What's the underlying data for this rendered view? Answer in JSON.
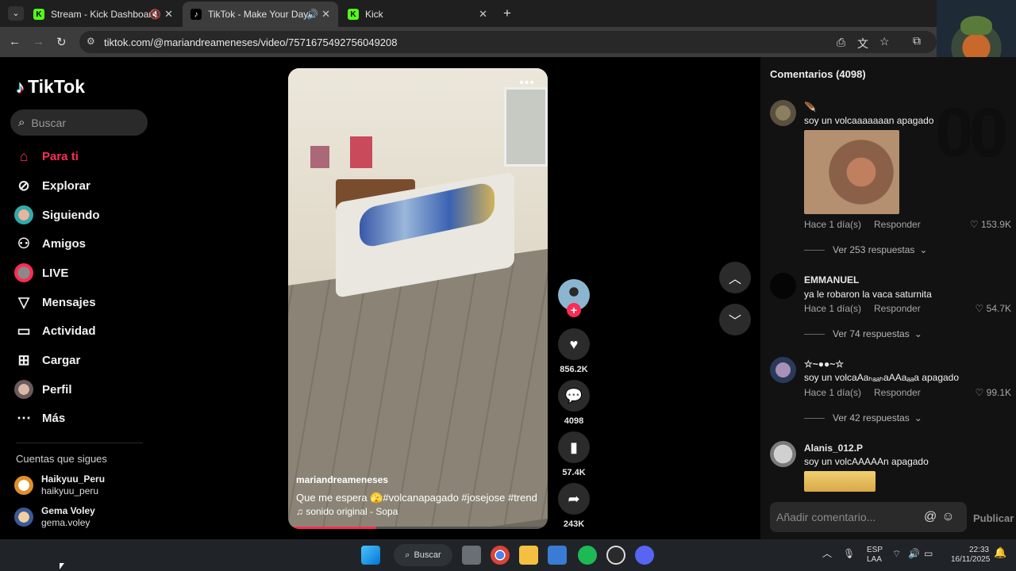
{
  "browser": {
    "tabs": [
      {
        "title": "Stream - Kick Dashboard",
        "favicon": "kick-icon",
        "muted": true
      },
      {
        "title": "TikTok - Make Your Day",
        "favicon": "tiktok-icon",
        "active": true
      },
      {
        "title": "Kick",
        "favicon": "kick-icon"
      }
    ],
    "new_tab": "+",
    "url": "tiktok.com/@mariandreameneses/video/7571675492756049208"
  },
  "sidebar": {
    "logo": "TikTok",
    "search_placeholder": "Buscar",
    "nav": [
      {
        "label": "Para ti",
        "icon": "home-icon",
        "active": true
      },
      {
        "label": "Explorar",
        "icon": "compass-icon"
      },
      {
        "label": "Siguiendo",
        "icon": "following-avatar-icon"
      },
      {
        "label": "Amigos",
        "icon": "friends-icon"
      },
      {
        "label": "LIVE",
        "icon": "live-icon"
      },
      {
        "label": "Mensajes",
        "icon": "messages-icon"
      },
      {
        "label": "Actividad",
        "icon": "activity-icon"
      },
      {
        "label": "Cargar",
        "icon": "upload-icon"
      },
      {
        "label": "Perfil",
        "icon": "profile-icon"
      },
      {
        "label": "Más",
        "icon": "more-icon"
      }
    ],
    "following_header": "Cuentas que sigues",
    "following": [
      {
        "name": "Haikyuu_Peru",
        "handle": "haikyuu_peru"
      },
      {
        "name": "Gema Voley",
        "handle": "gema.voley"
      }
    ]
  },
  "video": {
    "author": "mariandreameneses",
    "description": "Que me espera 🫣#volcanapagado #josejose #trend",
    "sound": "♫ sonido original - Sopa",
    "progress": 0.34,
    "likes": "856.2K",
    "comments": "4098",
    "saves": "57.4K",
    "shares": "243K"
  },
  "comments_panel": {
    "title": "Comentarios (4098)",
    "overlay": "00",
    "reply_label": "Responder",
    "items": [
      {
        "user": "🪶",
        "text": "soy un volcaaaaaaan apagado",
        "time": "Hace 1 día(s)",
        "likes": "153.9K",
        "replies": "Ver 253 respuestas",
        "has_image": true
      },
      {
        "user": "EMMANUEL",
        "text": "ya le robaron la vaca saturnita",
        "time": "Hace 1 día(s)",
        "likes": "54.7K",
        "replies": "Ver 74 respuestas"
      },
      {
        "user": "☆~●●~☆",
        "text": "soy un volcaAaₕₐₐₕaAAaₐₐa apagado",
        "time": "Hace 1 día(s)",
        "likes": "99.1K",
        "replies": "Ver 42 respuestas"
      },
      {
        "user": "Alanis_012.P",
        "text": "soy un volcAAAAAn apagado"
      }
    ],
    "add_placeholder": "Añadir comentario...",
    "publish": "Publicar"
  },
  "taskbar": {
    "search": "Buscar",
    "lang": "ESP",
    "layout": "LAA",
    "time": "22:33",
    "date": "16/11/2025"
  }
}
